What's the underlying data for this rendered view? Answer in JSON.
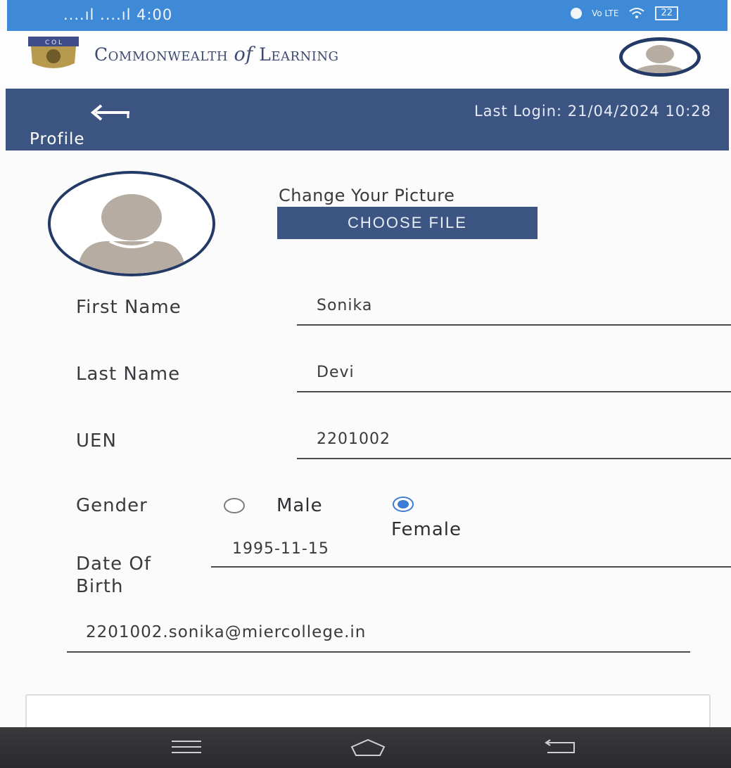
{
  "status_bar": {
    "time": "....ıl ....ıl 4:00",
    "network": "Vo LTE",
    "battery": "22"
  },
  "brand": {
    "logo_text": "C O L",
    "name_part1": "Commonwealth ",
    "name_of": "of",
    "name_part2": " Learning"
  },
  "header": {
    "last_login": "Last Login: 21/04/2024 10:28",
    "title": "Profile"
  },
  "picture": {
    "change_label": "Change Your Picture",
    "choose_file_label": "CHOOSE FILE"
  },
  "form": {
    "first_name_label": "First Name",
    "first_name_value": "Sonika",
    "last_name_label": "Last Name",
    "last_name_value": "Devi",
    "uen_label": "UEN",
    "uen_value": "2201002",
    "gender_label": "Gender",
    "gender_male": "Male",
    "gender_female": "Female",
    "gender_selected": "Female",
    "dob_label_line1": "Date Of",
    "dob_label_line2": "Birth",
    "dob_value": "1995-11-15",
    "email_value": "2201002.sonika@miercollege.in"
  },
  "colors": {
    "status_bar": "#3f8ad6",
    "nav_bar": "#3c5482",
    "accent": "#3d7bd4"
  },
  "icons": [
    "wifi-icon",
    "alarm-icon",
    "battery-icon",
    "back-arrow-icon",
    "user-avatar-icon",
    "menu-icon",
    "home-icon",
    "back-icon"
  ]
}
